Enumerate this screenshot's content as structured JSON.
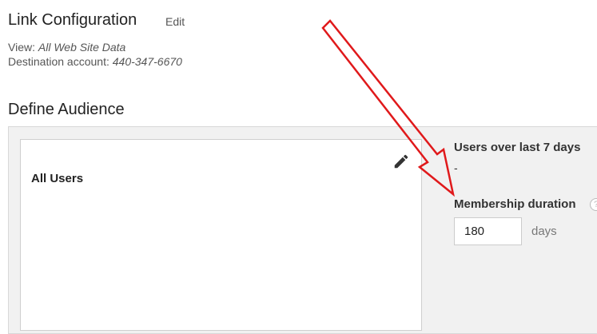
{
  "header": {
    "title": "Link Configuration",
    "edit_label": "Edit",
    "view_label": "View:",
    "view_value": "All Web Site Data",
    "destination_label": "Destination account:",
    "destination_value": "440-347-6670"
  },
  "define_audience": {
    "section_title": "Define Audience",
    "audience_name": "All Users",
    "users_label": "Users over last 7 days",
    "users_value": "-",
    "membership_label": "Membership duration",
    "membership_value": "180",
    "membership_unit": "days"
  },
  "icons": {
    "edit": "pencil-icon",
    "help": "help-icon",
    "annotation": "red-arrow-icon"
  },
  "colors": {
    "annotation_arrow": "#e0191b",
    "panel_background": "#f1f1f1"
  }
}
